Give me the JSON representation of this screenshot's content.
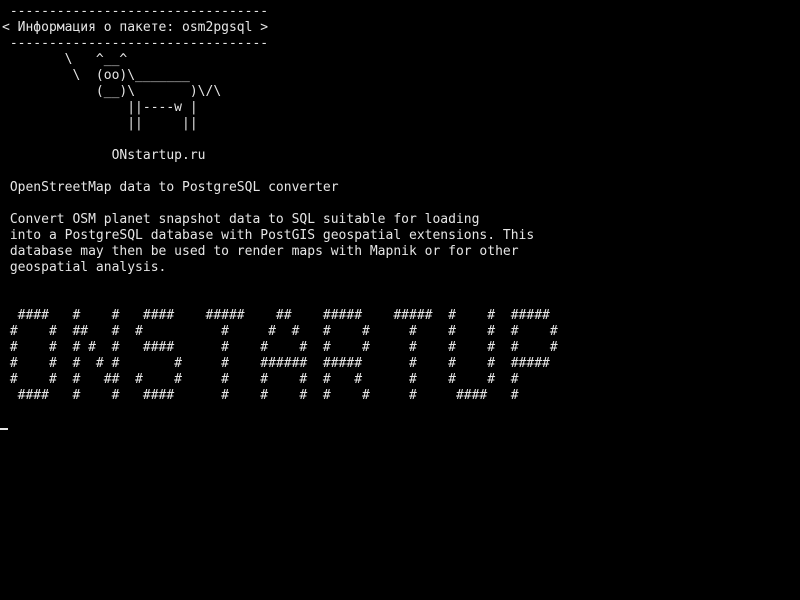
{
  "screen": {
    "lines": [
      " ---------------------------------",
      "< Информация о пакете: osm2pgsql >",
      " ---------------------------------",
      "        \\   ^__^",
      "         \\  (oo)\\_______",
      "            (__)\\       )\\/\\",
      "                ||----w |",
      "                ||     ||",
      "",
      "              ONstartup.ru",
      "",
      " OpenStreetMap data to PostgreSQL converter",
      "",
      " Convert OSM planet snapshot data to SQL suitable for loading",
      " into a PostgreSQL database with PostGIS geospatial extensions. This",
      " database may then be used to render maps with Mapnik or for other",
      " geospatial analysis.",
      "",
      "",
      "  ####   #    #   ####    #####    ##    #####    #####  #    #  #####",
      " #    #  ##   #  #          #     #  #   #    #     #    #    #  #    #",
      " #    #  # #  #   ####      #    #    #  #    #     #    #    #  #    #",
      " #    #  #  # #       #     #    ######  #####      #    #    #  #####",
      " #    #  #   ##  #    #     #    #    #  #   #      #    #    #  #",
      "  ####   #    #   ####      #    #    #  #    #     #     ####   #"
    ]
  }
}
